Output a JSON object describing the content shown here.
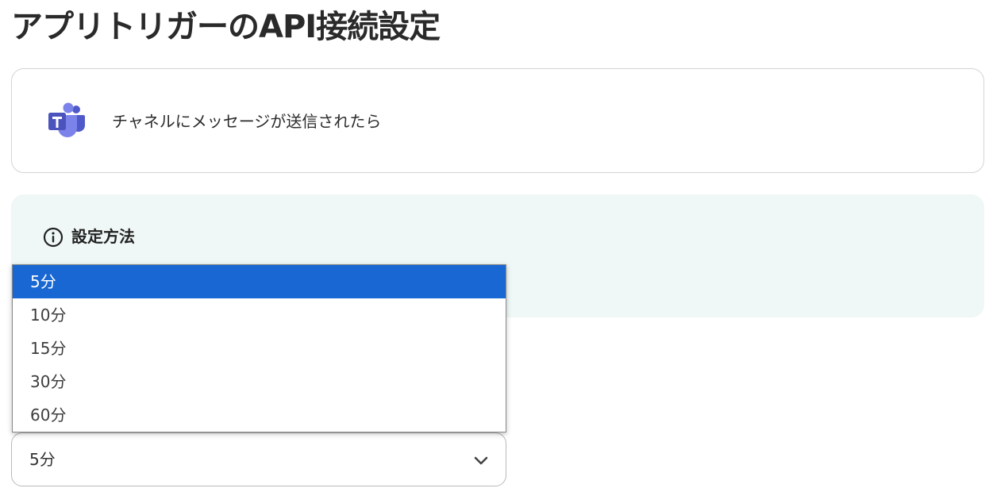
{
  "page": {
    "title": "アプリトリガーのAPI接続設定"
  },
  "trigger_card": {
    "app_icon": "microsoft-teams-icon",
    "label": "チャネルにメッセージが送信されたら"
  },
  "info_panel": {
    "icon": "info-icon",
    "heading": "設定方法"
  },
  "interval_select": {
    "selected_value": "5分",
    "options": [
      "5分",
      "10分",
      "15分",
      "30分",
      "60分"
    ],
    "highlighted_index": 0
  },
  "colors": {
    "highlight": "#1967d2",
    "info_panel_bg": "#eff8f6",
    "teams_purple": "#5059c9"
  }
}
